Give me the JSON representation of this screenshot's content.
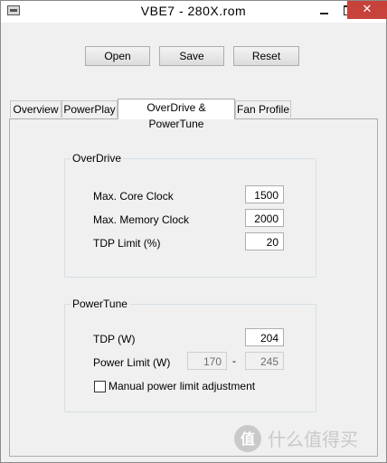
{
  "window": {
    "title": "VBE7 - 280X.rom",
    "close_glyph": "✕"
  },
  "toolbar": {
    "open_label": "Open",
    "save_label": "Save",
    "reset_label": "Reset"
  },
  "tabs": [
    {
      "label": "Overview",
      "active": false
    },
    {
      "label": "PowerPlay",
      "active": false
    },
    {
      "label": "OverDrive & PowerTune",
      "active": true
    },
    {
      "label": "Fan Profile",
      "active": false
    }
  ],
  "overdrive": {
    "title": "OverDrive",
    "core_clock": {
      "label": "Max. Core Clock",
      "value": "1500"
    },
    "memory_clock": {
      "label": "Max. Memory Clock",
      "value": "2000"
    },
    "tdp_limit": {
      "label": "TDP Limit (%)",
      "value": "20"
    }
  },
  "powertune": {
    "title": "PowerTune",
    "tdp": {
      "label": "TDP (W)",
      "value": "204"
    },
    "power_limit": {
      "label": "Power Limit (W)",
      "min": "170",
      "separator": "-",
      "max": "245"
    },
    "manual_adjust": {
      "label": "Manual power limit adjustment",
      "checked": false
    }
  },
  "watermark": {
    "text": "什么值得买"
  },
  "colors": {
    "close_button": "#c7423b",
    "window_bg": "#f0f0f0",
    "border": "#adadad"
  }
}
